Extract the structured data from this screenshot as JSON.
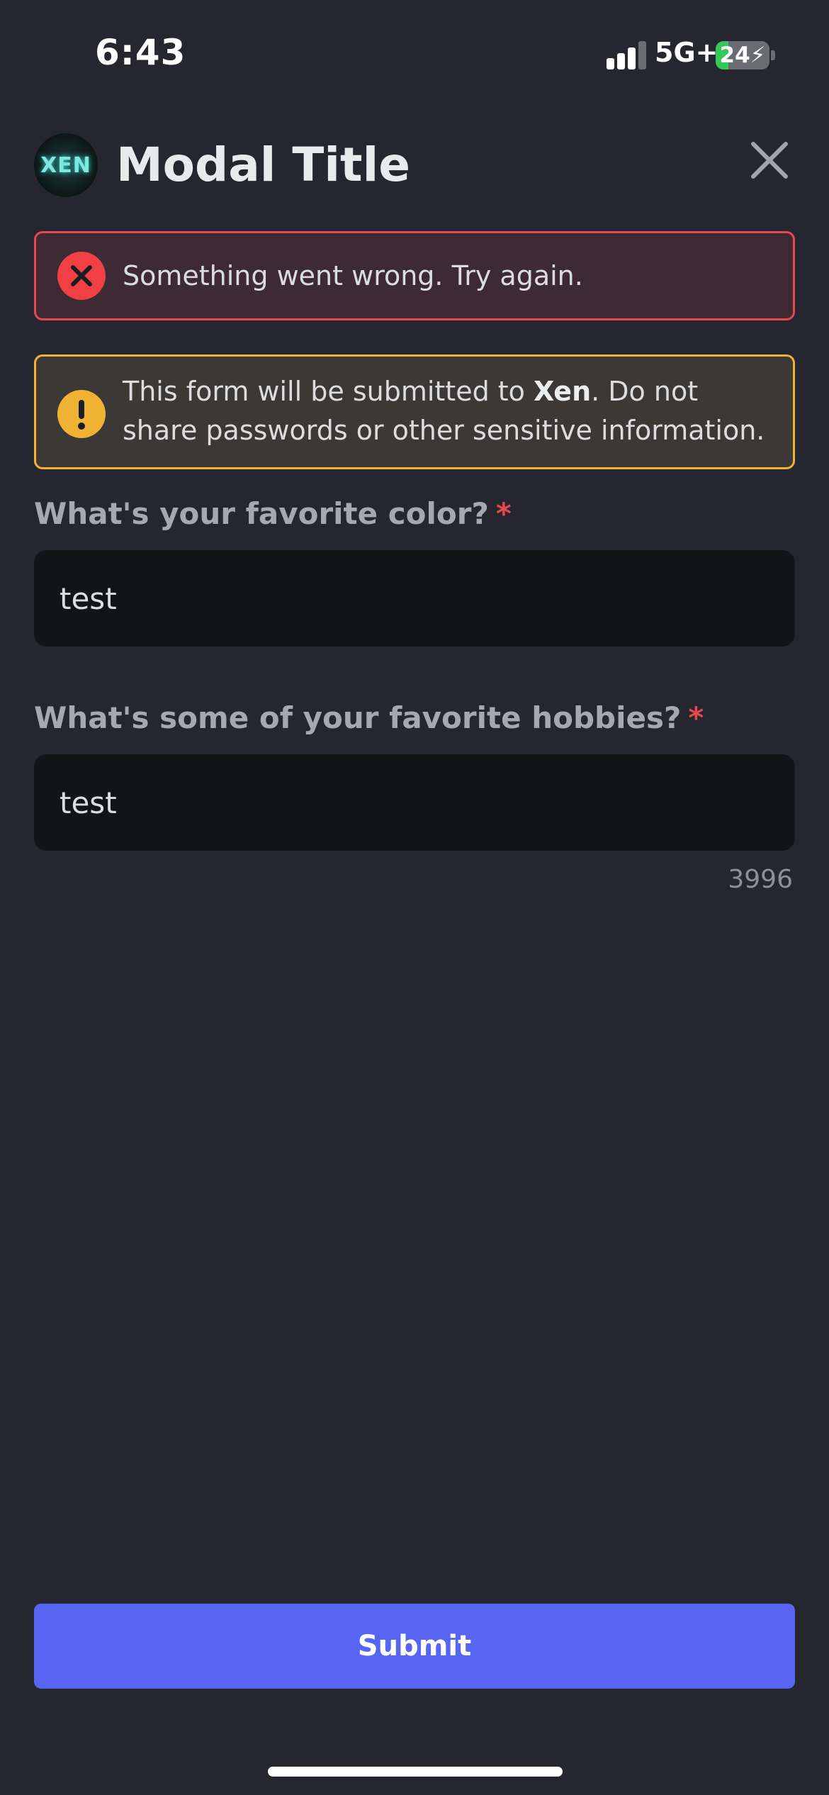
{
  "status_bar": {
    "time": "6:43",
    "network": "5G+",
    "battery": "24",
    "battery_level": 0.24
  },
  "modal": {
    "avatar_text": "XEN",
    "title": "Modal Title",
    "close_icon": "close-icon"
  },
  "error": {
    "icon": "error-x-icon",
    "message": "Something went wrong. Try again."
  },
  "warning": {
    "icon": "warning-exclamation-icon",
    "text_before": "This form will be submitted to ",
    "app_name": "Xen",
    "text_after": ". Do not share passwords or other sensitive information."
  },
  "fields": [
    {
      "label": "What's your favorite color?",
      "required_mark": "*",
      "value": "test"
    },
    {
      "label": "What's some of your favorite hobbies?",
      "required_mark": "*",
      "value": "test",
      "remaining_chars": "3996"
    }
  ],
  "submit": {
    "label": "Submit"
  },
  "colors": {
    "background": "#25262f",
    "error_border": "#e5484d",
    "warning_border": "#f0b232",
    "brand_button": "#5865f2",
    "input_bg": "#131419"
  }
}
